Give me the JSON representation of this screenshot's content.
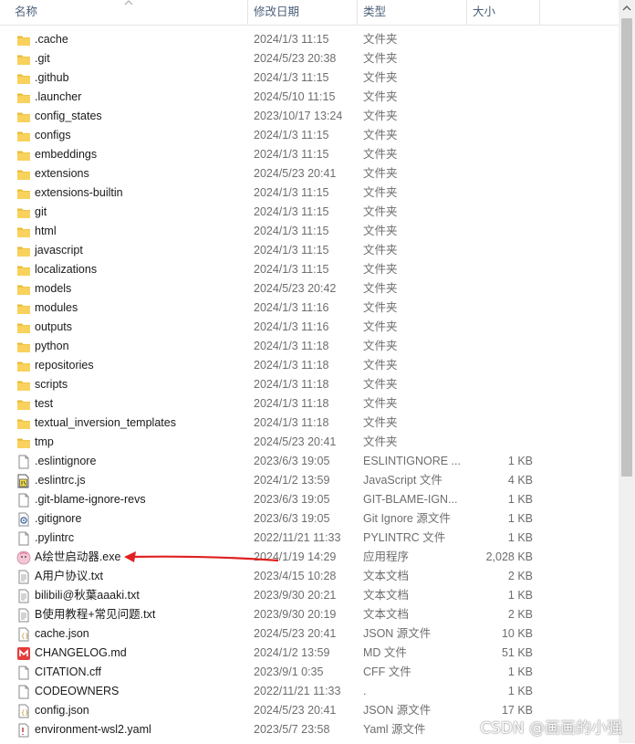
{
  "header": {
    "col_name": "名称",
    "col_date": "修改日期",
    "col_type": "类型",
    "col_size": "大小"
  },
  "files": [
    {
      "icon": "folder-icon",
      "name": ".cache",
      "date": "2024/1/3 11:15",
      "type": "文件夹",
      "size": ""
    },
    {
      "icon": "folder-icon",
      "name": ".git",
      "date": "2024/5/23 20:38",
      "type": "文件夹",
      "size": ""
    },
    {
      "icon": "folder-icon",
      "name": ".github",
      "date": "2024/1/3 11:15",
      "type": "文件夹",
      "size": ""
    },
    {
      "icon": "folder-icon",
      "name": ".launcher",
      "date": "2024/5/10 11:15",
      "type": "文件夹",
      "size": ""
    },
    {
      "icon": "folder-icon",
      "name": "config_states",
      "date": "2023/10/17 13:24",
      "type": "文件夹",
      "size": ""
    },
    {
      "icon": "folder-icon",
      "name": "configs",
      "date": "2024/1/3 11:15",
      "type": "文件夹",
      "size": ""
    },
    {
      "icon": "folder-icon",
      "name": "embeddings",
      "date": "2024/1/3 11:15",
      "type": "文件夹",
      "size": ""
    },
    {
      "icon": "folder-icon",
      "name": "extensions",
      "date": "2024/5/23 20:41",
      "type": "文件夹",
      "size": ""
    },
    {
      "icon": "folder-icon",
      "name": "extensions-builtin",
      "date": "2024/1/3 11:15",
      "type": "文件夹",
      "size": ""
    },
    {
      "icon": "folder-icon",
      "name": "git",
      "date": "2024/1/3 11:15",
      "type": "文件夹",
      "size": ""
    },
    {
      "icon": "folder-icon",
      "name": "html",
      "date": "2024/1/3 11:15",
      "type": "文件夹",
      "size": ""
    },
    {
      "icon": "folder-icon",
      "name": "javascript",
      "date": "2024/1/3 11:15",
      "type": "文件夹",
      "size": ""
    },
    {
      "icon": "folder-icon",
      "name": "localizations",
      "date": "2024/1/3 11:15",
      "type": "文件夹",
      "size": ""
    },
    {
      "icon": "folder-icon",
      "name": "models",
      "date": "2024/5/23 20:42",
      "type": "文件夹",
      "size": ""
    },
    {
      "icon": "folder-icon",
      "name": "modules",
      "date": "2024/1/3 11:16",
      "type": "文件夹",
      "size": ""
    },
    {
      "icon": "folder-icon",
      "name": "outputs",
      "date": "2024/1/3 11:16",
      "type": "文件夹",
      "size": ""
    },
    {
      "icon": "folder-icon",
      "name": "python",
      "date": "2024/1/3 11:18",
      "type": "文件夹",
      "size": ""
    },
    {
      "icon": "folder-icon",
      "name": "repositories",
      "date": "2024/1/3 11:18",
      "type": "文件夹",
      "size": ""
    },
    {
      "icon": "folder-icon",
      "name": "scripts",
      "date": "2024/1/3 11:18",
      "type": "文件夹",
      "size": ""
    },
    {
      "icon": "folder-icon",
      "name": "test",
      "date": "2024/1/3 11:18",
      "type": "文件夹",
      "size": ""
    },
    {
      "icon": "folder-icon",
      "name": "textual_inversion_templates",
      "date": "2024/1/3 11:18",
      "type": "文件夹",
      "size": ""
    },
    {
      "icon": "folder-icon",
      "name": "tmp",
      "date": "2024/5/23 20:41",
      "type": "文件夹",
      "size": ""
    },
    {
      "icon": "file-icon",
      "name": ".eslintignore",
      "date": "2023/6/3 19:05",
      "type": "ESLINTIGNORE ...",
      "size": "1 KB"
    },
    {
      "icon": "js-file-icon",
      "name": ".eslintrc.js",
      "date": "2024/1/2 13:59",
      "type": "JavaScript 文件",
      "size": "4 KB"
    },
    {
      "icon": "file-icon",
      "name": ".git-blame-ignore-revs",
      "date": "2023/6/3 19:05",
      "type": "GIT-BLAME-IGN...",
      "size": "1 KB"
    },
    {
      "icon": "gear-file-icon",
      "name": ".gitignore",
      "date": "2023/6/3 19:05",
      "type": "Git Ignore 源文件",
      "size": "1 KB"
    },
    {
      "icon": "file-icon",
      "name": ".pylintrc",
      "date": "2022/11/21 11:33",
      "type": "PYLINTRC 文件",
      "size": "1 KB"
    },
    {
      "icon": "app-exe-icon",
      "name": "A绘世启动器.exe",
      "date": "2024/1/19 14:29",
      "type": "应用程序",
      "size": "2,028 KB"
    },
    {
      "icon": "text-file-icon",
      "name": "A用户协议.txt",
      "date": "2023/4/15 10:28",
      "type": "文本文档",
      "size": "2 KB"
    },
    {
      "icon": "text-file-icon",
      "name": "bilibili@秋葉aaaki.txt",
      "date": "2023/9/30 20:21",
      "type": "文本文档",
      "size": "1 KB"
    },
    {
      "icon": "text-file-icon",
      "name": "B使用教程+常见问题.txt",
      "date": "2023/9/30 20:19",
      "type": "文本文档",
      "size": "2 KB"
    },
    {
      "icon": "json-file-icon",
      "name": "cache.json",
      "date": "2024/5/23 20:41",
      "type": "JSON 源文件",
      "size": "10 KB"
    },
    {
      "icon": "md-file-icon",
      "name": "CHANGELOG.md",
      "date": "2024/1/2 13:59",
      "type": "MD 文件",
      "size": "51 KB"
    },
    {
      "icon": "file-icon",
      "name": "CITATION.cff",
      "date": "2023/9/1 0:35",
      "type": "CFF 文件",
      "size": "1 KB"
    },
    {
      "icon": "file-icon",
      "name": "CODEOWNERS",
      "date": "2022/11/21 11:33",
      "type": ".",
      "size": "1 KB"
    },
    {
      "icon": "json-file-icon",
      "name": "config.json",
      "date": "2024/5/23 20:41",
      "type": "JSON 源文件",
      "size": "17 KB"
    },
    {
      "icon": "yaml-file-icon",
      "name": "environment-wsl2.yaml",
      "date": "2023/5/7 23:58",
      "type": "Yaml 源文件",
      "size": ""
    }
  ],
  "watermark": "CSDN @画画的小强",
  "colors": {
    "folder": "#f8d25c",
    "folder_dark": "#e8b830",
    "annotation_arrow": "#e02020",
    "header_text": "#4c607a"
  }
}
